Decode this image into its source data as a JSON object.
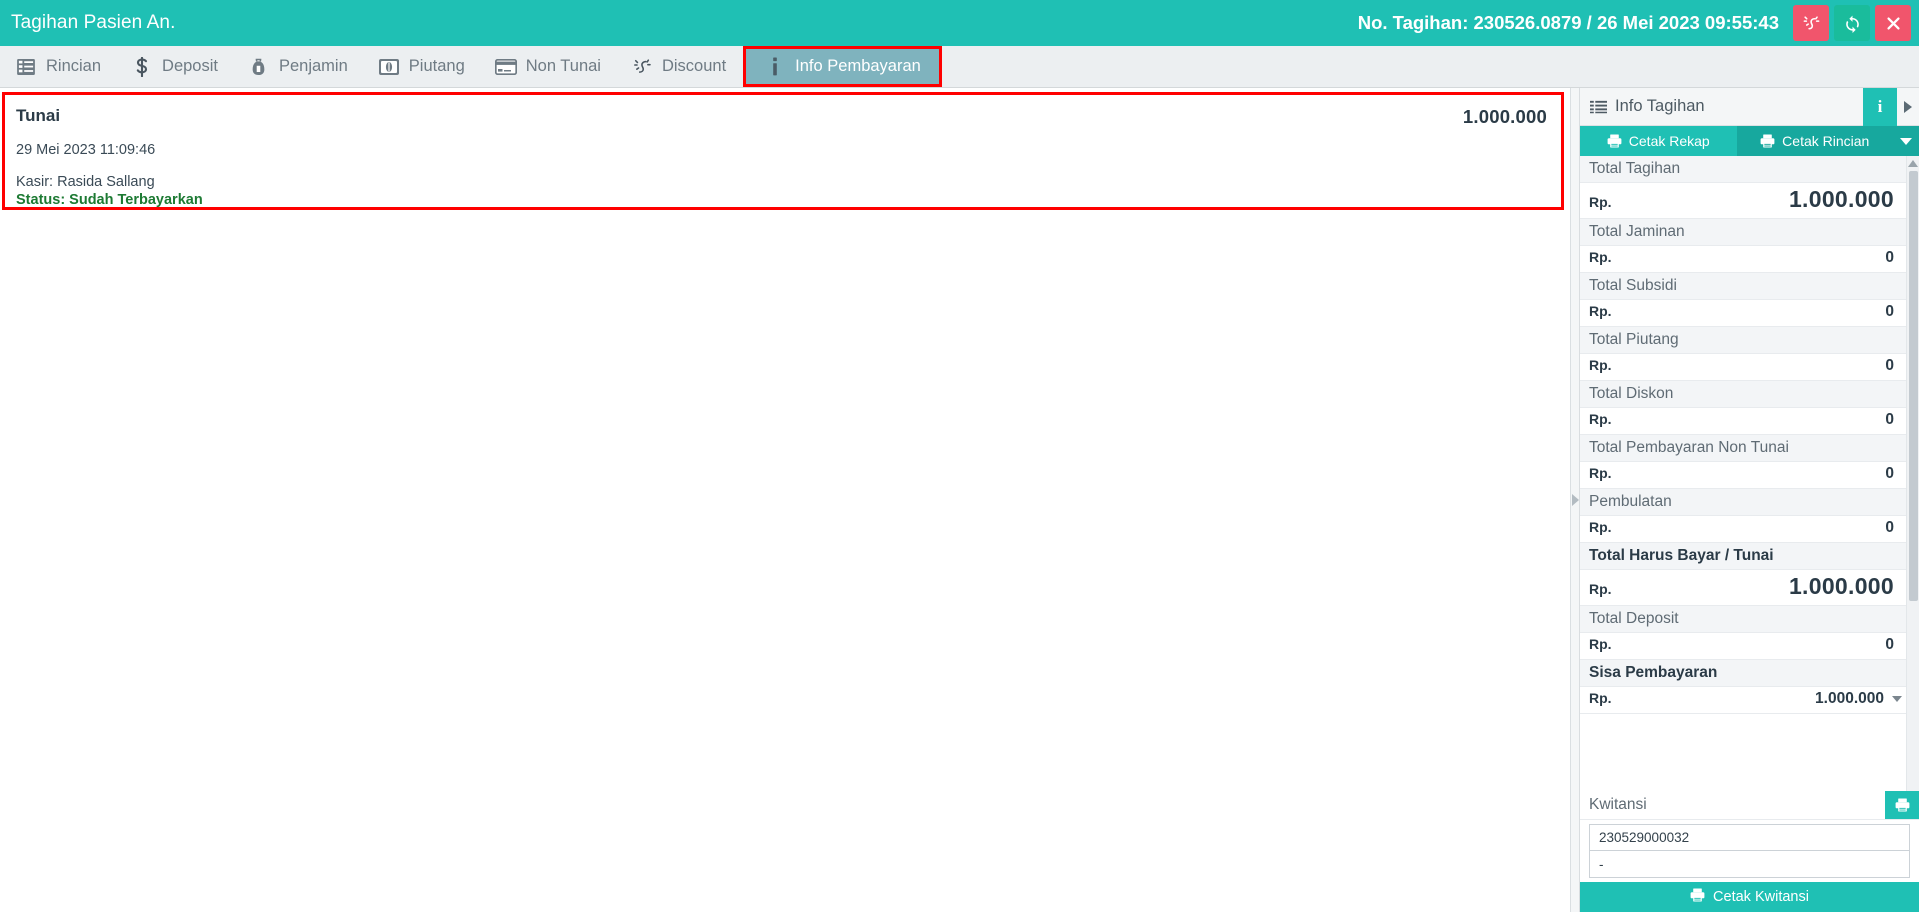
{
  "titlebar": {
    "title": "Tagihan Pasien An.",
    "bill_info": "No. Tagihan: 230526.0879 / 26 Mei 2023 09:55:43",
    "accent_color": "#1fc0b4",
    "buttons": [
      {
        "name": "discount-icon",
        "label": "",
        "color": "#f1556c"
      },
      {
        "name": "refresh-icon",
        "label": "",
        "color": "#1abc9c"
      },
      {
        "name": "close-icon",
        "label": "",
        "color": "#f1556c"
      }
    ]
  },
  "tabs": [
    {
      "label": "Rincian",
      "icon": "list-icon",
      "active": false
    },
    {
      "label": "Deposit",
      "icon": "dollar-icon",
      "active": false
    },
    {
      "label": "Penjamin",
      "icon": "bag-icon",
      "active": false
    },
    {
      "label": "Piutang",
      "icon": "coin-icon",
      "active": false
    },
    {
      "label": "Non Tunai",
      "icon": "card-icon",
      "active": false
    },
    {
      "label": "Discount",
      "icon": "discount-icon",
      "active": false
    },
    {
      "label": "Info Pembayaran",
      "icon": "info-icon",
      "active": true
    }
  ],
  "payment": {
    "method": "Tunai",
    "amount": "1.000.000",
    "datetime": "29 Mei 2023 11:09:46",
    "cashier": "Kasir: Rasida Sallang",
    "status": "Status: Sudah Terbayarkan",
    "status_color": "#1d7a33",
    "highlight_color": "#ff0000"
  },
  "sidebar": {
    "header_title": "Info Tagihan",
    "header_icon": "list-icon",
    "info_button_label": "i",
    "expand_icon": "chevron-right-icon",
    "print_buttons": {
      "rekap": "Cetak Rekap",
      "rincian": "Cetak Rincian"
    },
    "totals": [
      {
        "label": "Total Tagihan",
        "currency": "Rp.",
        "value": "1.000.000",
        "big": true,
        "strong": false
      },
      {
        "label": "Total Jaminan",
        "currency": "Rp.",
        "value": "0",
        "big": false,
        "strong": false
      },
      {
        "label": "Total Subsidi",
        "currency": "Rp.",
        "value": "0",
        "big": false,
        "strong": false
      },
      {
        "label": "Total Piutang",
        "currency": "Rp.",
        "value": "0",
        "big": false,
        "strong": false
      },
      {
        "label": "Total Diskon",
        "currency": "Rp.",
        "value": "0",
        "big": false,
        "strong": false
      },
      {
        "label": "Total Pembayaran Non Tunai",
        "currency": "Rp.",
        "value": "0",
        "big": false,
        "strong": false
      },
      {
        "label": "Pembulatan",
        "currency": "Rp.",
        "value": "0",
        "big": false,
        "strong": false
      },
      {
        "label": "Total Harus Bayar / Tunai",
        "currency": "Rp.",
        "value": "1.000.000",
        "big": true,
        "strong": true
      },
      {
        "label": "Total Deposit",
        "currency": "Rp.",
        "value": "0",
        "big": false,
        "strong": false
      },
      {
        "label": "Sisa Pembayaran",
        "currency": "Rp.",
        "value": "1.000.000",
        "big": false,
        "strong": true,
        "caret": true
      }
    ],
    "kwitansi": {
      "label": "Kwitansi",
      "field1": "230529000032",
      "field2": "-",
      "print_button": "Cetak Kwitansi"
    }
  }
}
